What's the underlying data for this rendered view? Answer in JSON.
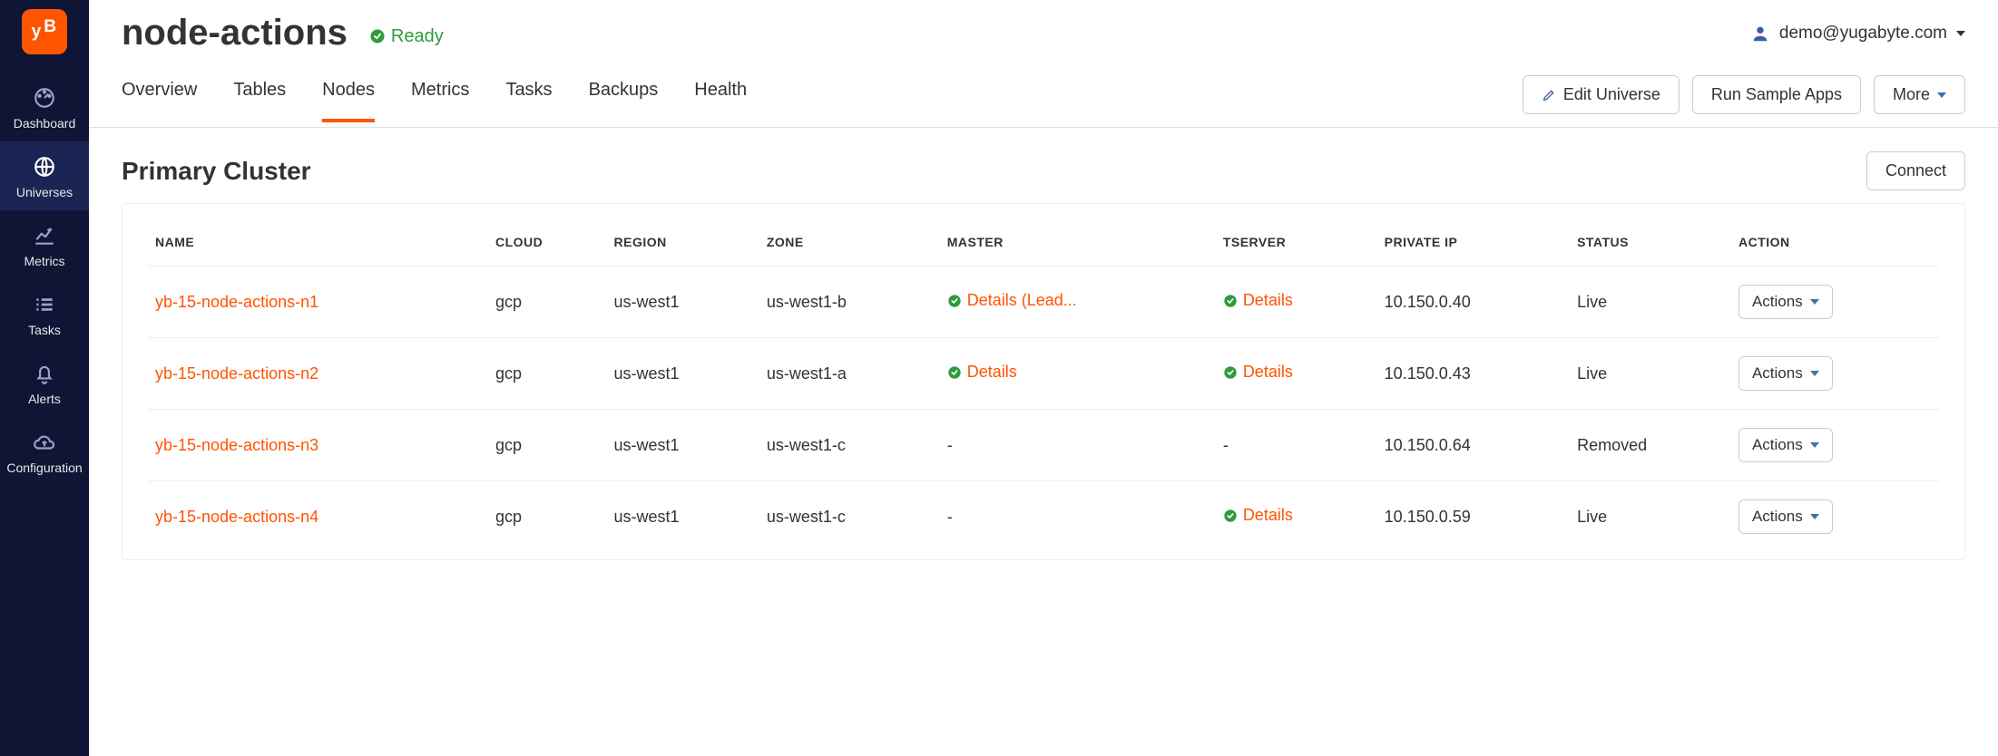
{
  "header": {
    "title": "node-actions",
    "status_label": "Ready",
    "user_label": "demo@yugabyte.com"
  },
  "sidebar": {
    "items": [
      {
        "label": "Dashboard"
      },
      {
        "label": "Universes"
      },
      {
        "label": "Metrics"
      },
      {
        "label": "Tasks"
      },
      {
        "label": "Alerts"
      },
      {
        "label": "Configuration"
      }
    ]
  },
  "tabs": {
    "items": [
      {
        "label": "Overview"
      },
      {
        "label": "Tables"
      },
      {
        "label": "Nodes"
      },
      {
        "label": "Metrics"
      },
      {
        "label": "Tasks"
      },
      {
        "label": "Backups"
      },
      {
        "label": "Health"
      }
    ],
    "active_index": 2
  },
  "buttons": {
    "edit_universe": "Edit Universe",
    "run_sample": "Run Sample Apps",
    "more": "More",
    "connect": "Connect",
    "actions": "Actions"
  },
  "section": {
    "title": "Primary Cluster"
  },
  "table": {
    "headers": {
      "name": "NAME",
      "cloud": "CLOUD",
      "region": "REGION",
      "zone": "ZONE",
      "master": "MASTER",
      "tserver": "TSERVER",
      "private_ip": "PRIVATE IP",
      "status": "STATUS",
      "action": "ACTION"
    },
    "rows": [
      {
        "name": "yb-15-node-actions-n1",
        "cloud": "gcp",
        "region": "us-west1",
        "zone": "us-west1-b",
        "master": "Details (Lead...",
        "tserver": "Details",
        "private_ip": "10.150.0.40",
        "status": "Live"
      },
      {
        "name": "yb-15-node-actions-n2",
        "cloud": "gcp",
        "region": "us-west1",
        "zone": "us-west1-a",
        "master": "Details",
        "tserver": "Details",
        "private_ip": "10.150.0.43",
        "status": "Live"
      },
      {
        "name": "yb-15-node-actions-n3",
        "cloud": "gcp",
        "region": "us-west1",
        "zone": "us-west1-c",
        "master": "-",
        "tserver": "-",
        "private_ip": "10.150.0.64",
        "status": "Removed"
      },
      {
        "name": "yb-15-node-actions-n4",
        "cloud": "gcp",
        "region": "us-west1",
        "zone": "us-west1-c",
        "master": "-",
        "tserver": "Details",
        "private_ip": "10.150.0.59",
        "status": "Live"
      }
    ]
  }
}
